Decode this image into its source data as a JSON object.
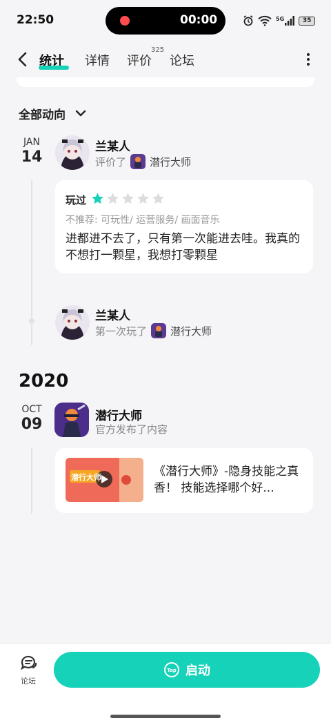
{
  "status_bar": {
    "time": "22:50",
    "recording_time": "00:00",
    "network": "5G",
    "battery": "35"
  },
  "nav": {
    "tabs": [
      {
        "label": "统计",
        "active": true
      },
      {
        "label": "详情",
        "active": false
      },
      {
        "label": "评价",
        "active": false,
        "badge": "325"
      },
      {
        "label": "论坛",
        "active": false
      }
    ]
  },
  "filter": {
    "label": "全部动向"
  },
  "feed": {
    "entry1": {
      "month": "JAN",
      "day": "14",
      "user": "兰某人",
      "action": "评价了",
      "game": "潜行大师",
      "review": {
        "played_label": "玩过",
        "rating": 1,
        "max_rating": 5,
        "tags": "不推荐: 可玩性/ 运营服务/ 画面音乐",
        "text": "进都进不去了，只有第一次能进去哇。我真的不想打一颗星，我想打零颗星"
      }
    },
    "entry2": {
      "user": "兰某人",
      "action": "第一次玩了",
      "game": "潜行大师"
    },
    "year": "2020",
    "entry3": {
      "month": "OCT",
      "day": "09",
      "name": "潜行大师",
      "action": "官方发布了内容",
      "post_title": "《潜行大师》-隐身技能之真香！ 技能选择哪个好...",
      "post_thumb_text": "潜行大师"
    }
  },
  "bottom": {
    "forum_label": "论坛",
    "launch_label": "启动",
    "tap_logo": "Tap"
  },
  "colors": {
    "accent": "#15d2b8",
    "background": "#f5f5f7"
  }
}
